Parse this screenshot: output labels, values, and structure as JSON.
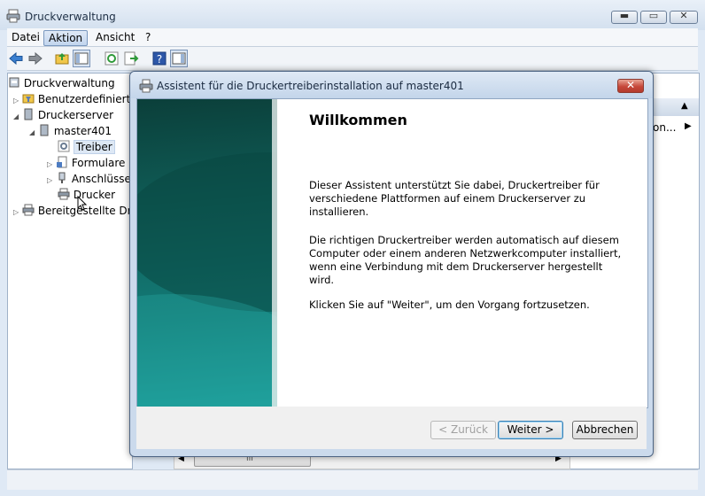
{
  "window": {
    "title": "Druckverwaltung"
  },
  "menu": {
    "items": [
      "Datei",
      "Aktion",
      "Ansicht",
      "?"
    ]
  },
  "toolbar": {
    "icons": [
      "back-arrow-icon",
      "forward-arrow-icon",
      "folder-up-icon",
      "console-tree-icon",
      "refresh-icon",
      "export-list-icon",
      "help-icon",
      "show-hide-action-pane-icon"
    ]
  },
  "tree": {
    "root": "Druckverwaltung",
    "items": [
      {
        "label": "Benutzerdefinierte"
      },
      {
        "label": "Druckerserver"
      },
      {
        "label": "master401"
      },
      {
        "label": "Treiber"
      },
      {
        "label": "Formulare"
      },
      {
        "label": "Anschlüsse"
      },
      {
        "label": "Drucker"
      },
      {
        "label": "Bereitgestellte Dru"
      }
    ]
  },
  "right_pane": {
    "partial_text": "on..."
  },
  "hscroll": {
    "grip": "III"
  },
  "dialog": {
    "title": "Assistent für die Druckertreiberinstallation auf master401",
    "headline": "Willkommen",
    "paragraphs": [
      "Dieser Assistent unterstützt Sie dabei, Druckertreiber für verschiedene Plattformen auf einem Druckerserver zu installieren.",
      "Die richtigen Druckertreiber werden automatisch auf diesem Computer oder einem anderen Netzwerkcomputer installiert, wenn eine Verbindung mit dem Druckerserver hergestellt wird.",
      "Klicken Sie auf \"Weiter\", um den Vorgang fortzusetzen."
    ],
    "buttons": {
      "back": "< Zurück",
      "next": "Weiter >",
      "cancel": "Abbrechen"
    },
    "close_glyph": "✕"
  },
  "colors": {
    "accent": "#3c7fb1",
    "sidebar_teal": "#137c78",
    "close_red": "#c6483a"
  }
}
